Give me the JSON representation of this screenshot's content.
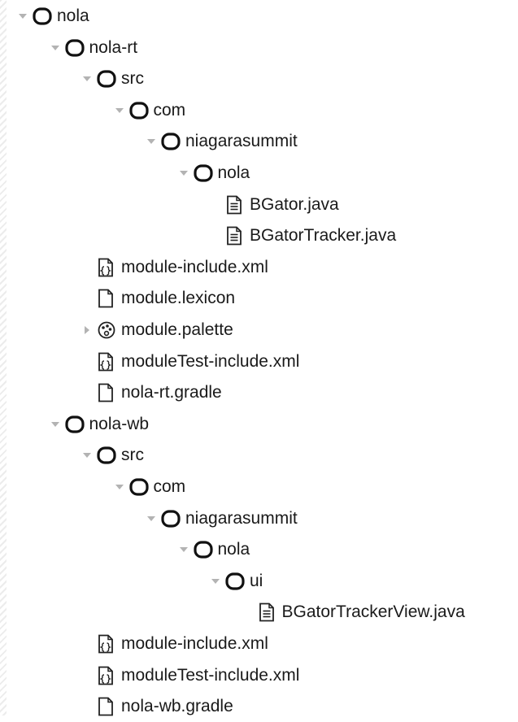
{
  "tree": {
    "rows": [
      {
        "label": "nola",
        "depth": 0,
        "toggle": "expanded",
        "icon": "folder-icon"
      },
      {
        "label": "nola-rt",
        "depth": 1,
        "toggle": "expanded",
        "icon": "folder-icon"
      },
      {
        "label": "src",
        "depth": 2,
        "toggle": "expanded",
        "icon": "folder-icon"
      },
      {
        "label": "com",
        "depth": 3,
        "toggle": "expanded",
        "icon": "folder-icon"
      },
      {
        "label": "niagarasummit",
        "depth": 4,
        "toggle": "expanded",
        "icon": "folder-icon"
      },
      {
        "label": "nola",
        "depth": 5,
        "toggle": "expanded",
        "icon": "folder-icon"
      },
      {
        "label": "BGator.java",
        "depth": 6,
        "toggle": "none",
        "icon": "java-file-icon"
      },
      {
        "label": "BGatorTracker.java",
        "depth": 6,
        "toggle": "none",
        "icon": "java-file-icon"
      },
      {
        "label": "module-include.xml",
        "depth": 2,
        "toggle": "none",
        "icon": "xml-file-icon"
      },
      {
        "label": "module.lexicon",
        "depth": 2,
        "toggle": "none",
        "icon": "file-icon"
      },
      {
        "label": "module.palette",
        "depth": 2,
        "toggle": "collapsed",
        "icon": "palette-icon"
      },
      {
        "label": "moduleTest-include.xml",
        "depth": 2,
        "toggle": "none",
        "icon": "xml-file-icon"
      },
      {
        "label": "nola-rt.gradle",
        "depth": 2,
        "toggle": "none",
        "icon": "file-icon"
      },
      {
        "label": "nola-wb",
        "depth": 1,
        "toggle": "expanded",
        "icon": "folder-icon"
      },
      {
        "label": "src",
        "depth": 2,
        "toggle": "expanded",
        "icon": "folder-icon"
      },
      {
        "label": "com",
        "depth": 3,
        "toggle": "expanded",
        "icon": "folder-icon"
      },
      {
        "label": "niagarasummit",
        "depth": 4,
        "toggle": "expanded",
        "icon": "folder-icon"
      },
      {
        "label": "nola",
        "depth": 5,
        "toggle": "expanded",
        "icon": "folder-icon"
      },
      {
        "label": "ui",
        "depth": 6,
        "toggle": "expanded",
        "icon": "folder-icon"
      },
      {
        "label": "BGatorTrackerView.java",
        "depth": 7,
        "toggle": "none",
        "icon": "java-file-icon"
      },
      {
        "label": "module-include.xml",
        "depth": 2,
        "toggle": "none",
        "icon": "xml-file-icon"
      },
      {
        "label": "moduleTest-include.xml",
        "depth": 2,
        "toggle": "none",
        "icon": "xml-file-icon"
      },
      {
        "label": "nola-wb.gradle",
        "depth": 2,
        "toggle": "none",
        "icon": "file-icon"
      }
    ]
  }
}
